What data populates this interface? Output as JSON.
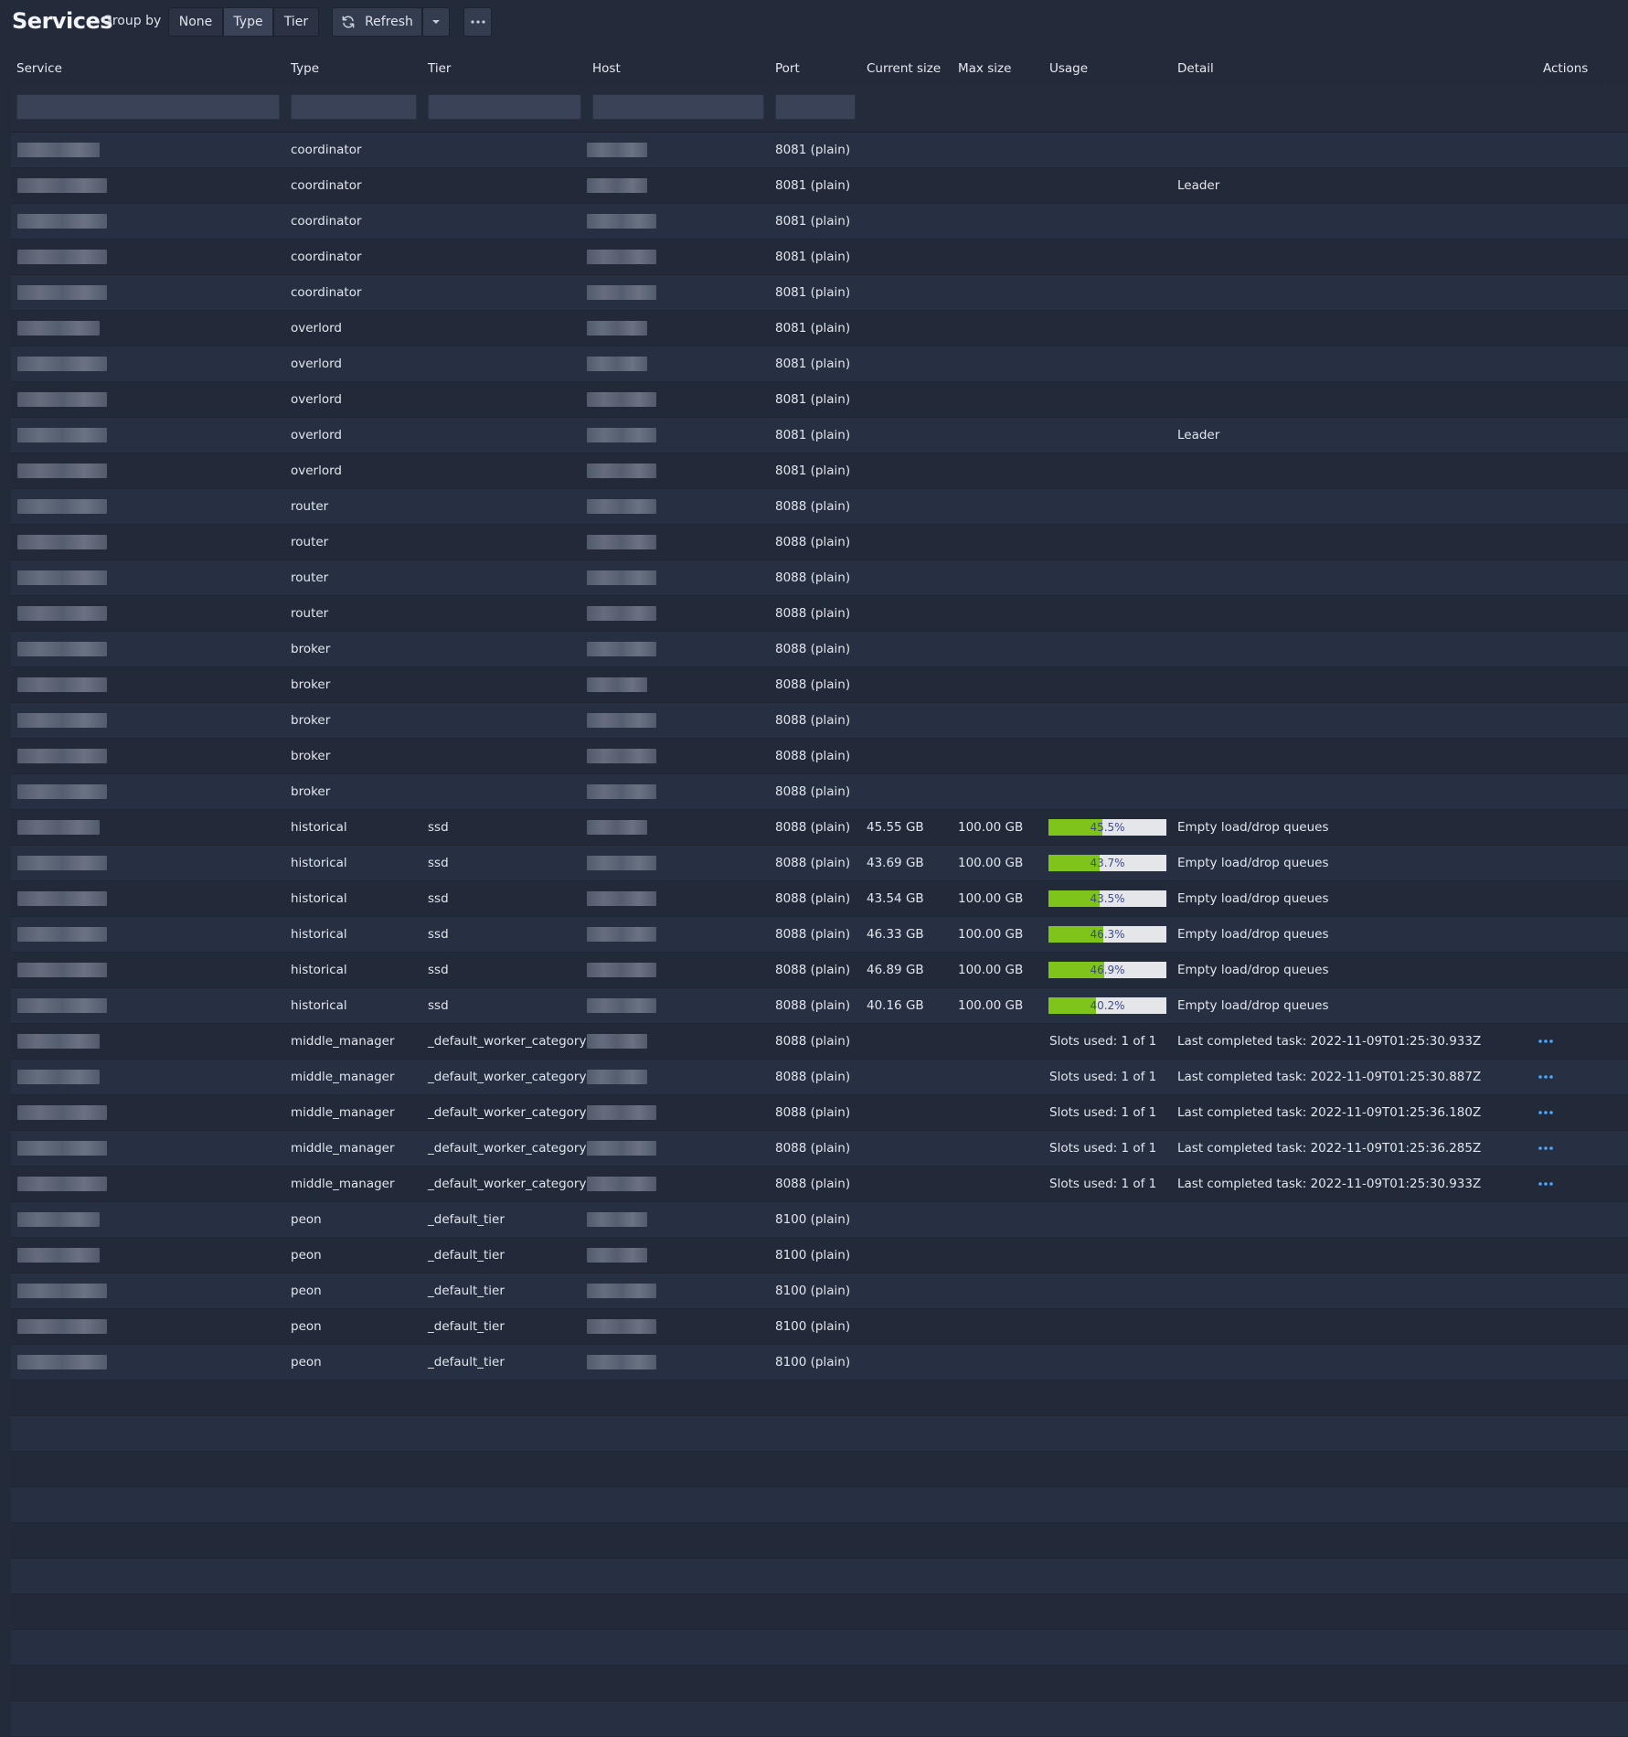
{
  "header": {
    "title": "Services",
    "group_by_label": "Group by",
    "group_by_options": [
      "None",
      "Type",
      "Tier"
    ],
    "group_by_selected": "Type",
    "refresh_label": "Refresh"
  },
  "table": {
    "columns": [
      "Service",
      "Type",
      "Tier",
      "Host",
      "Port",
      "Current size",
      "Max size",
      "Usage",
      "Detail",
      "Actions"
    ],
    "rows": [
      {
        "type": "coordinator",
        "tier": "",
        "port": "8081 (plain)",
        "current": "",
        "max": "",
        "usage": "",
        "usage_pct": null,
        "detail": "",
        "action": false
      },
      {
        "type": "coordinator",
        "tier": "",
        "port": "8081 (plain)",
        "current": "",
        "max": "",
        "usage": "",
        "usage_pct": null,
        "detail": "Leader",
        "action": false
      },
      {
        "type": "coordinator",
        "tier": "",
        "port": "8081 (plain)",
        "current": "",
        "max": "",
        "usage": "",
        "usage_pct": null,
        "detail": "",
        "action": false
      },
      {
        "type": "coordinator",
        "tier": "",
        "port": "8081 (plain)",
        "current": "",
        "max": "",
        "usage": "",
        "usage_pct": null,
        "detail": "",
        "action": false
      },
      {
        "type": "coordinator",
        "tier": "",
        "port": "8081 (plain)",
        "current": "",
        "max": "",
        "usage": "",
        "usage_pct": null,
        "detail": "",
        "action": false
      },
      {
        "type": "overlord",
        "tier": "",
        "port": "8081 (plain)",
        "current": "",
        "max": "",
        "usage": "",
        "usage_pct": null,
        "detail": "",
        "action": false
      },
      {
        "type": "overlord",
        "tier": "",
        "port": "8081 (plain)",
        "current": "",
        "max": "",
        "usage": "",
        "usage_pct": null,
        "detail": "",
        "action": false
      },
      {
        "type": "overlord",
        "tier": "",
        "port": "8081 (plain)",
        "current": "",
        "max": "",
        "usage": "",
        "usage_pct": null,
        "detail": "",
        "action": false
      },
      {
        "type": "overlord",
        "tier": "",
        "port": "8081 (plain)",
        "current": "",
        "max": "",
        "usage": "",
        "usage_pct": null,
        "detail": "Leader",
        "action": false
      },
      {
        "type": "overlord",
        "tier": "",
        "port": "8081 (plain)",
        "current": "",
        "max": "",
        "usage": "",
        "usage_pct": null,
        "detail": "",
        "action": false
      },
      {
        "type": "router",
        "tier": "",
        "port": "8088 (plain)",
        "current": "",
        "max": "",
        "usage": "",
        "usage_pct": null,
        "detail": "",
        "action": false
      },
      {
        "type": "router",
        "tier": "",
        "port": "8088 (plain)",
        "current": "",
        "max": "",
        "usage": "",
        "usage_pct": null,
        "detail": "",
        "action": false
      },
      {
        "type": "router",
        "tier": "",
        "port": "8088 (plain)",
        "current": "",
        "max": "",
        "usage": "",
        "usage_pct": null,
        "detail": "",
        "action": false
      },
      {
        "type": "router",
        "tier": "",
        "port": "8088 (plain)",
        "current": "",
        "max": "",
        "usage": "",
        "usage_pct": null,
        "detail": "",
        "action": false
      },
      {
        "type": "broker",
        "tier": "",
        "port": "8088 (plain)",
        "current": "",
        "max": "",
        "usage": "",
        "usage_pct": null,
        "detail": "",
        "action": false
      },
      {
        "type": "broker",
        "tier": "",
        "port": "8088 (plain)",
        "current": "",
        "max": "",
        "usage": "",
        "usage_pct": null,
        "detail": "",
        "action": false
      },
      {
        "type": "broker",
        "tier": "",
        "port": "8088 (plain)",
        "current": "",
        "max": "",
        "usage": "",
        "usage_pct": null,
        "detail": "",
        "action": false
      },
      {
        "type": "broker",
        "tier": "",
        "port": "8088 (plain)",
        "current": "",
        "max": "",
        "usage": "",
        "usage_pct": null,
        "detail": "",
        "action": false
      },
      {
        "type": "broker",
        "tier": "",
        "port": "8088 (plain)",
        "current": "",
        "max": "",
        "usage": "",
        "usage_pct": null,
        "detail": "",
        "action": false
      },
      {
        "type": "historical",
        "tier": "ssd",
        "port": "8088 (plain)",
        "current": "45.55 GB",
        "max": "100.00 GB",
        "usage": "45.5%",
        "usage_pct": 45.5,
        "detail": "Empty load/drop queues",
        "action": false
      },
      {
        "type": "historical",
        "tier": "ssd",
        "port": "8088 (plain)",
        "current": "43.69 GB",
        "max": "100.00 GB",
        "usage": "43.7%",
        "usage_pct": 43.7,
        "detail": "Empty load/drop queues",
        "action": false
      },
      {
        "type": "historical",
        "tier": "ssd",
        "port": "8088 (plain)",
        "current": "43.54 GB",
        "max": "100.00 GB",
        "usage": "43.5%",
        "usage_pct": 43.5,
        "detail": "Empty load/drop queues",
        "action": false
      },
      {
        "type": "historical",
        "tier": "ssd",
        "port": "8088 (plain)",
        "current": "46.33 GB",
        "max": "100.00 GB",
        "usage": "46.3%",
        "usage_pct": 46.3,
        "detail": "Empty load/drop queues",
        "action": false
      },
      {
        "type": "historical",
        "tier": "ssd",
        "port": "8088 (plain)",
        "current": "46.89 GB",
        "max": "100.00 GB",
        "usage": "46.9%",
        "usage_pct": 46.9,
        "detail": "Empty load/drop queues",
        "action": false
      },
      {
        "type": "historical",
        "tier": "ssd",
        "port": "8088 (plain)",
        "current": "40.16 GB",
        "max": "100.00 GB",
        "usage": "40.2%",
        "usage_pct": 40.2,
        "detail": "Empty load/drop queues",
        "action": false
      },
      {
        "type": "middle_manager",
        "tier": "_default_worker_category",
        "port": "8088 (plain)",
        "current": "",
        "max": "",
        "usage": "Slots used: 1 of 1",
        "usage_pct": null,
        "detail": "Last completed task: 2022-11-09T01:25:30.933Z",
        "action": true
      },
      {
        "type": "middle_manager",
        "tier": "_default_worker_category",
        "port": "8088 (plain)",
        "current": "",
        "max": "",
        "usage": "Slots used: 1 of 1",
        "usage_pct": null,
        "detail": "Last completed task: 2022-11-09T01:25:30.887Z",
        "action": true
      },
      {
        "type": "middle_manager",
        "tier": "_default_worker_category",
        "port": "8088 (plain)",
        "current": "",
        "max": "",
        "usage": "Slots used: 1 of 1",
        "usage_pct": null,
        "detail": "Last completed task: 2022-11-09T01:25:36.180Z",
        "action": true
      },
      {
        "type": "middle_manager",
        "tier": "_default_worker_category",
        "port": "8088 (plain)",
        "current": "",
        "max": "",
        "usage": "Slots used: 1 of 1",
        "usage_pct": null,
        "detail": "Last completed task: 2022-11-09T01:25:36.285Z",
        "action": true
      },
      {
        "type": "middle_manager",
        "tier": "_default_worker_category",
        "port": "8088 (plain)",
        "current": "",
        "max": "",
        "usage": "Slots used: 1 of 1",
        "usage_pct": null,
        "detail": "Last completed task: 2022-11-09T01:25:30.933Z",
        "action": true
      },
      {
        "type": "peon",
        "tier": "_default_tier",
        "port": "8100 (plain)",
        "current": "",
        "max": "",
        "usage": "",
        "usage_pct": null,
        "detail": "",
        "action": false
      },
      {
        "type": "peon",
        "tier": "_default_tier",
        "port": "8100 (plain)",
        "current": "",
        "max": "",
        "usage": "",
        "usage_pct": null,
        "detail": "",
        "action": false
      },
      {
        "type": "peon",
        "tier": "_default_tier",
        "port": "8100 (plain)",
        "current": "",
        "max": "",
        "usage": "",
        "usage_pct": null,
        "detail": "",
        "action": false
      },
      {
        "type": "peon",
        "tier": "_default_tier",
        "port": "8100 (plain)",
        "current": "",
        "max": "",
        "usage": "",
        "usage_pct": null,
        "detail": "",
        "action": false
      },
      {
        "type": "peon",
        "tier": "_default_tier",
        "port": "8100 (plain)",
        "current": "",
        "max": "",
        "usage": "",
        "usage_pct": null,
        "detail": "",
        "action": false
      }
    ]
  },
  "colors": {
    "background": "#232a3a",
    "row_alt": "#273042",
    "usage_fill": "#7fc41b",
    "usage_track": "#e4e6ea",
    "usage_text": "#3e4a8a",
    "action_dots": "#4aa8ff"
  },
  "icons": {
    "refresh": "refresh-icon",
    "caret": "caret-down-icon",
    "more": "more-horizontal-icon",
    "actions": "more-horizontal-icon"
  }
}
